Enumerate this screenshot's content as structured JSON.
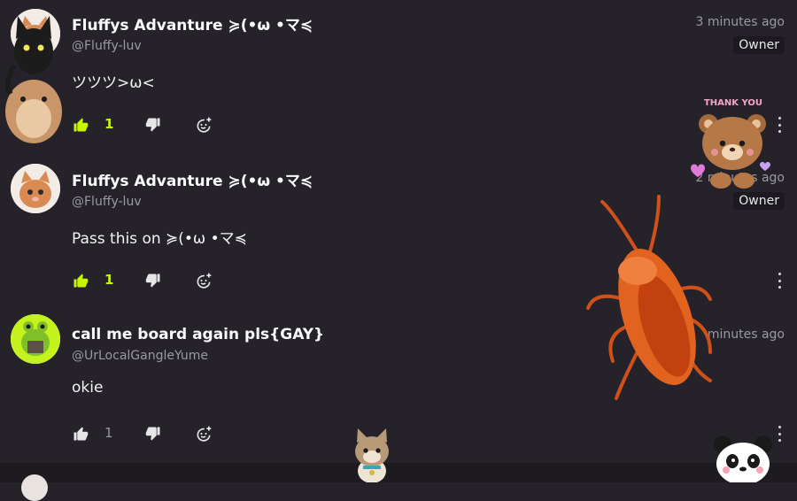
{
  "comments": [
    {
      "author": "Fluffys Advanture ≽(•ω •マ≼",
      "handle": "@Fluffy-luv",
      "time": "3 minutes ago",
      "badge": "Owner",
      "text": "ツツツ>ω<",
      "likes": "1",
      "liked": true
    },
    {
      "author": "Fluffys Advanture ≽(•ω •マ≼",
      "handle": "@Fluffy-luv",
      "time": "2 minutes ago",
      "badge": "Owner",
      "text": "Pass this on ≽(•ω •マ≼",
      "likes": "1",
      "liked": true
    },
    {
      "author": "call me board again pls{GAY}",
      "handle": "@UrLocalGangleYume",
      "time": "minutes ago",
      "text": "okie",
      "likes": "1",
      "liked": false
    }
  ],
  "stickers": {
    "thank_you": "THANK YOU"
  },
  "colors": {
    "background": "#25222a",
    "like_active": "#c8f500",
    "muted": "#9a98a2"
  },
  "icons": [
    "thumbs-up-icon",
    "thumbs-down-icon",
    "reply-icon",
    "more-vertical-icon"
  ]
}
